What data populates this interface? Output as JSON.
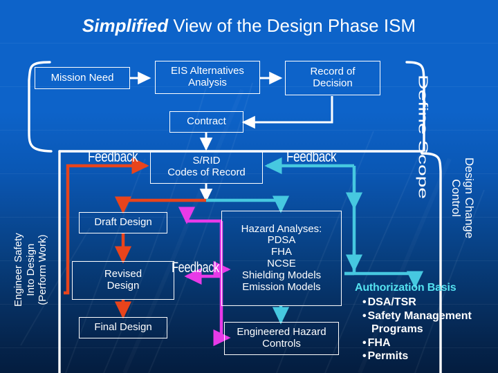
{
  "slide": {
    "title_emphasis": "Simplified",
    "title_rest": " View of the Design Phase ISM",
    "background_color": "#0d63c9",
    "background_color_bottom": "#041d3f"
  },
  "phases": {
    "define_scope": "Define Scope",
    "engineer_safety": [
      "Engineer Safety",
      "Into Design",
      "(Perform Work)"
    ],
    "design_change_control": [
      "Design Change",
      "Control"
    ]
  },
  "boxes": {
    "mission_need": "Mission Need",
    "eis_alternatives": "EIS Alternatives\nAnalysis",
    "record_of_decision": "Record of\nDecision",
    "contract": "Contract",
    "srid": "S/RID\nCodes of Record",
    "draft_design": "Draft Design",
    "revised_design": "Revised\nDesign",
    "final_design": "Final Design",
    "hazard_analyses": "Hazard Analyses:\nPDSA\nFHA\nNCSE\nShielding Models\nEmission Models",
    "engineered_hazard_controls": "Engineered Hazard\nControls"
  },
  "labels": {
    "feedback_left": "Feedback",
    "feedback_right": "Feedback",
    "feedback_middle": "Feedback"
  },
  "authorization": {
    "title": "Authorization Basis",
    "title_color": "#54e2f0",
    "items": [
      "DSA/TSR",
      "Safety Management",
      "Programs",
      "FHA",
      "Permits"
    ]
  },
  "colors": {
    "white": "#ffffff",
    "red_arrow": "#e8441c",
    "cyan_arrow": "#46c8e0",
    "magenta_arrow": "#e83ae8",
    "accent_cyan": "#54e2f0"
  }
}
